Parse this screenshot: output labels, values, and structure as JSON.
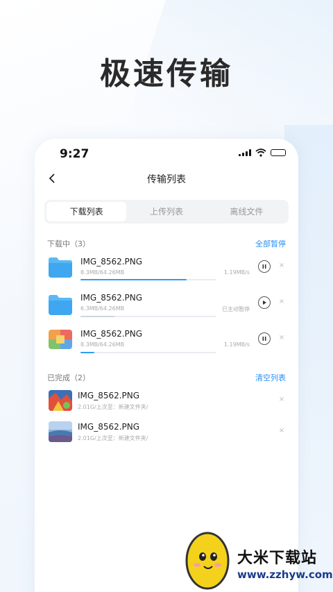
{
  "headline": "极速传输",
  "status": {
    "time": "9:27"
  },
  "nav": {
    "title": "传输列表"
  },
  "tabs": [
    {
      "label": "下载列表",
      "active": true
    },
    {
      "label": "上传列表",
      "active": false
    },
    {
      "label": "离线文件",
      "active": false
    }
  ],
  "downloading": {
    "title": "下载中（3）",
    "action": "全部暂停",
    "items": [
      {
        "name": "IMG_8562.PNG",
        "size": "8.3MB/64.26MB",
        "status": "1.19MB/s",
        "progress": 0.78,
        "control": "pause-icon",
        "icon": "folder-icon"
      },
      {
        "name": "IMG_8562.PNG",
        "size": "6.3MB/64.26MB",
        "status": "已主动暂停",
        "progress": 0.25,
        "control": "play-icon",
        "icon": "folder-icon"
      },
      {
        "name": "IMG_8562.PNG",
        "size": "8.3MB/64.26MB",
        "status": "1.19MB/s",
        "progress": 0.1,
        "control": "pause-icon",
        "icon": "image-icon"
      }
    ]
  },
  "completed": {
    "title": "已完成（2）",
    "action": "清空列表",
    "items": [
      {
        "name": "IMG_8562.PNG",
        "meta": "2.01G/上次至：新建文件夹/"
      },
      {
        "name": "IMG_8562.PNG",
        "meta": "2.01G/上次至：新建文件夹/"
      }
    ]
  },
  "close_glyph": "×",
  "watermark": {
    "title": "大米下载站",
    "url": "www.zzhyw.com"
  },
  "colors": {
    "accent": "#2a8ff5",
    "progress": "#2a9df4",
    "folder": "#3fa7f0"
  }
}
